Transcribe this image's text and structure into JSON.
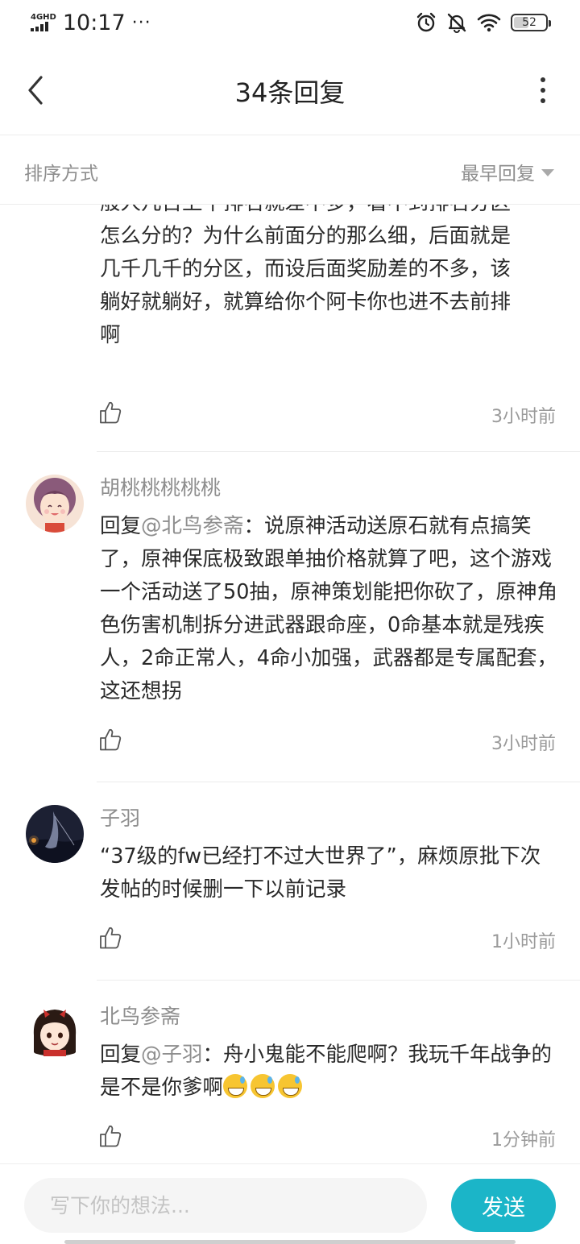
{
  "status_bar": {
    "network": "4GHD",
    "time": "10:17",
    "overflow": "···",
    "icons": [
      "alarm-icon",
      "mute-bell-icon",
      "wifi-icon"
    ],
    "battery": "52",
    "battery_level": 0.52
  },
  "header": {
    "title": "34条回复",
    "back_icon": "chevron-left-icon",
    "more_icon": "more-vertical-icon"
  },
  "sort": {
    "label": "排序方式",
    "value": "最早回复"
  },
  "comments": [
    {
      "text_lines": [
        "般人几百上千排名就差不多，看不到排名分区",
        "怎么分的？为什么前面分的那么细，后面就是",
        "几千几千的分区，而设后面奖励差的不多，该",
        "躺好就躺好，就算给你个阿卡你也进不去前排",
        "啊"
      ],
      "time": "3小时前"
    },
    {
      "name": "胡桃桃桃桃桃",
      "reply_prefix": "回复",
      "mention": "@北鸟参斋",
      "text": "：说原神活动送原石就有点搞笑了，原神保底极致跟单抽价格就算了吧，这个游戏一个活动送了50抽，原神策划能把你砍了，原神角色伤害机制拆分进武器跟命座，0命基本就是残疾人，2命正常人，4命小加强，武器都是专属配套，这还想拐",
      "time": "3小时前"
    },
    {
      "name": "子羽",
      "text": "“37级的fw已经打不过大世界了”，麻烦原批下次发帖的时候删一下以前记录",
      "time": "1小时前"
    },
    {
      "name": "北鸟参斋",
      "reply_prefix": "回复",
      "mention": "@子羽",
      "text": "：舟小鬼能不能爬啊？我玩千年战争的是不是你爹啊",
      "emoji_icon": "grinning-sweat-emoji",
      "time": "1分钟前"
    }
  ],
  "composer": {
    "placeholder": "写下你的想法...",
    "send_label": "发送"
  },
  "colors": {
    "accent": "#1bb5c8",
    "secondary_text": "#8e8e8e",
    "primary_text": "#2a2a2a",
    "divider": "#ececec"
  }
}
